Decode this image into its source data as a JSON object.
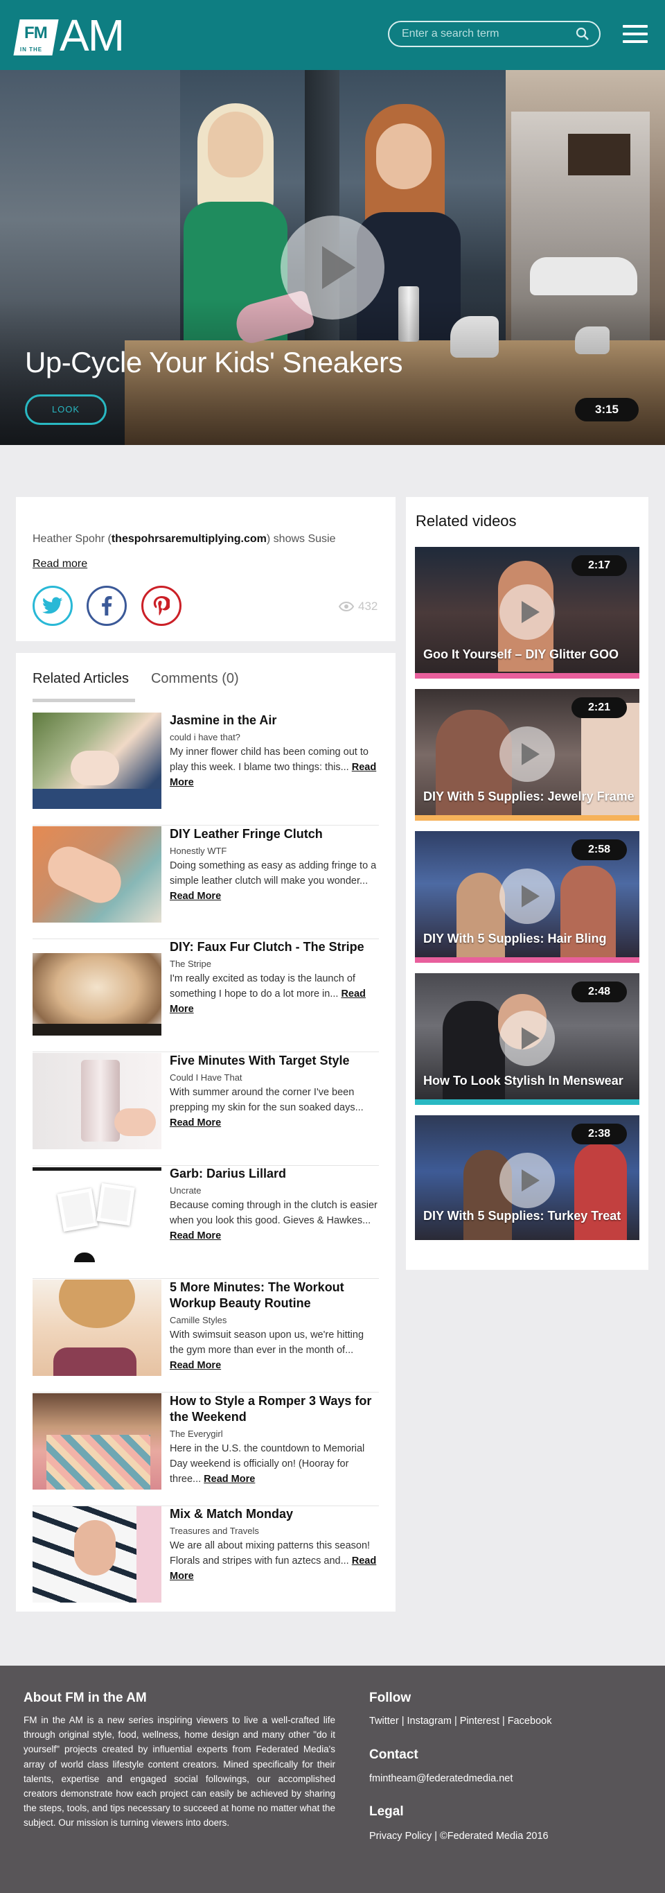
{
  "header": {
    "logo_fm": "FM",
    "logo_inthe": "IN THE",
    "logo_am": "AM",
    "search_placeholder": "Enter a search term",
    "colors": {
      "brand": "#0e7e82"
    }
  },
  "hero": {
    "title": "Up-Cycle Your Kids' Sneakers",
    "look_label": "LOOK",
    "duration": "3:15"
  },
  "description": {
    "lead": "Heather Spohr (",
    "link_text": "thespohrsaremultiplying.com",
    "tail": ") shows Susie",
    "read_more": "Read more",
    "views": "432",
    "share_icons": [
      "twitter-icon",
      "facebook-icon",
      "pinterest-icon"
    ]
  },
  "tabs": {
    "articles": "Related Articles",
    "comments": "Comments (0)"
  },
  "articles": [
    {
      "title": "Jasmine in the Air",
      "source": "could i have that?",
      "text": "My inner flower child has been coming out to play this week. I blame two things: this...",
      "more": "Read More"
    },
    {
      "title": "DIY Leather Fringe Clutch",
      "source": "Honestly WTF",
      "text": "Doing something as easy as adding fringe to a simple leather clutch will make you wonder...",
      "more": "Read More"
    },
    {
      "title": "DIY: Faux Fur Clutch - The Stripe",
      "source": "The Stripe",
      "text": "I'm really excited as today is the launch of something I hope to do a lot more in...",
      "more": "Read More"
    },
    {
      "title": "Five Minutes With Target Style",
      "source": "Could I Have That",
      "text": "With summer around the corner I've been prepping my skin for the sun soaked days...",
      "more": "Read More"
    },
    {
      "title": "Garb: Darius Lillard",
      "source": "Uncrate",
      "text": "Because coming through in the clutch is easier when you look this good. Gieves & Hawkes...",
      "more": "Read More"
    },
    {
      "title": "5 More Minutes: The Workout Workup Beauty Routine",
      "source": "Camille Styles",
      "text": "With swimsuit season upon us, we're hitting the gym more than ever in the month of...",
      "more": "Read More"
    },
    {
      "title": "How to Style a Romper 3 Ways for the Weekend",
      "source": "The Everygirl",
      "text": "Here in the U.S. the countdown to Memorial Day weekend is officially on! (Hooray for three...",
      "more": "Read More"
    },
    {
      "title": "Mix & Match Monday",
      "source": "Treasures and Travels",
      "text": "We are all about mixing patterns this season! Florals and stripes with fun aztecs and...",
      "more": "Read More"
    }
  ],
  "related": {
    "title": "Related videos",
    "videos": [
      {
        "title": "Goo It Yourself – DIY Glitter GOO",
        "duration": "2:17",
        "accent": "#e85f9c"
      },
      {
        "title": "DIY With 5 Supplies: Jewelry Frame",
        "duration": "2:21",
        "accent": "#f6b25a"
      },
      {
        "title": "DIY With 5 Supplies: Hair Bling",
        "duration": "2:58",
        "accent": "#e85f9c"
      },
      {
        "title": "How To Look Stylish In Menswear",
        "duration": "2:48",
        "accent": "#29b8c2"
      },
      {
        "title": "DIY With 5 Supplies: Turkey Treat",
        "duration": "2:38",
        "accent": "#6a6a6a"
      }
    ]
  },
  "footer": {
    "about_title": "About FM in the AM",
    "about_text": "FM in the AM is a new series inspiring viewers to live a well-crafted life through original style, food, wellness, home design and many other \"do it yourself\" projects created by influential experts from Federated Media's array of world class lifestyle content creators. Mined specifically for their talents, expertise and engaged social followings, our accomplished creators demonstrate how each project can easily be achieved by sharing the steps, tools, and tips necessary to succeed at home no matter what the subject. Our mission is turning viewers into doers.",
    "follow_title": "Follow",
    "follow_links": [
      "Twitter",
      "Instagram",
      "Pinterest",
      "Facebook"
    ],
    "contact_title": "Contact",
    "contact_email": "fmintheam@federatedmedia.net",
    "legal_title": "Legal",
    "privacy": "Privacy Policy",
    "copyright": "©Federated Media 2016"
  }
}
